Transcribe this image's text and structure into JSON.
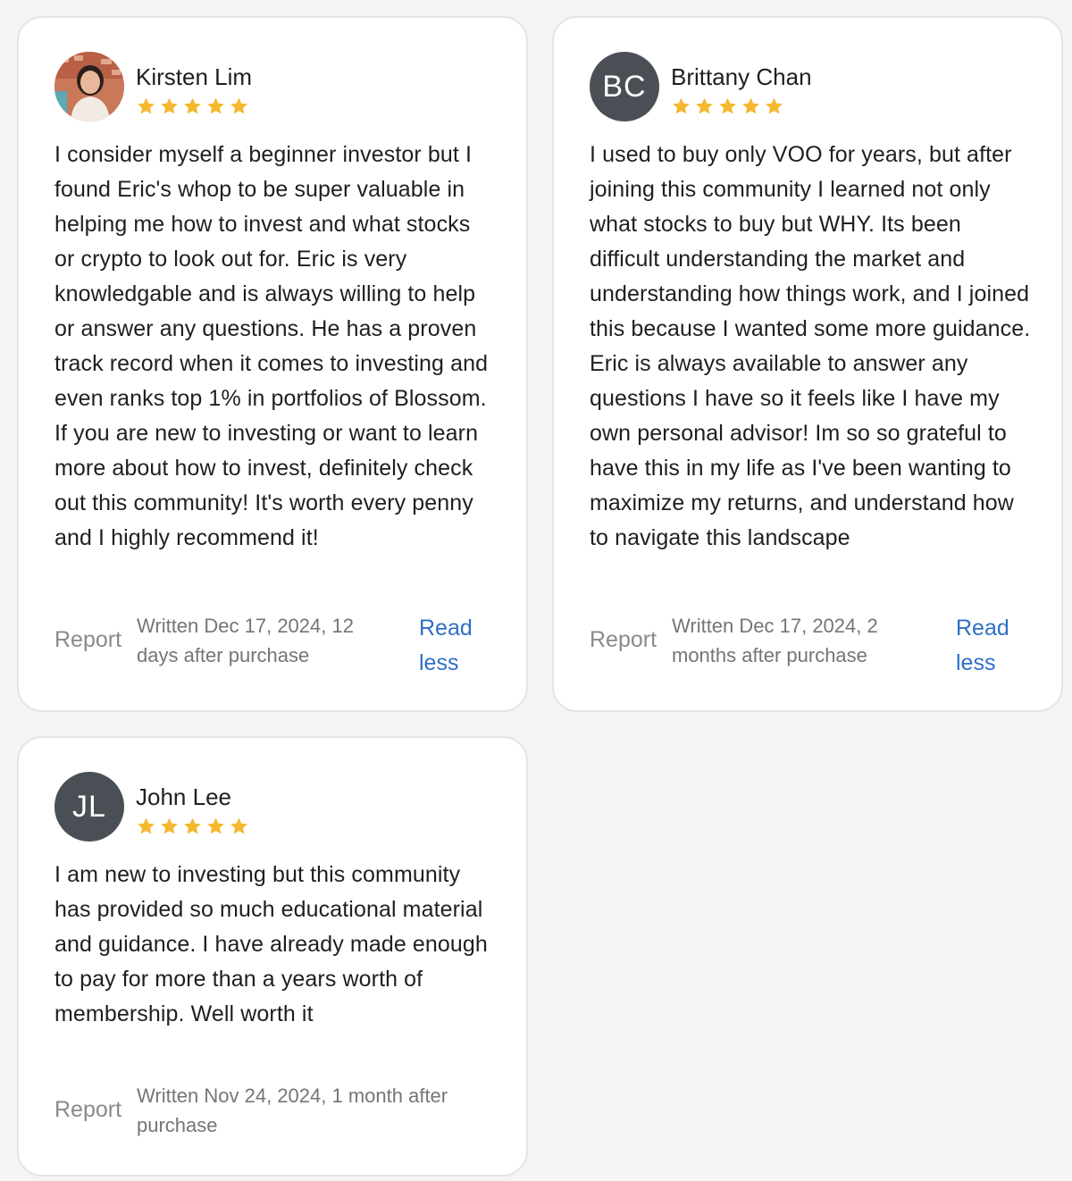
{
  "reviews": [
    {
      "name": "Kirsten Lim",
      "avatar_initials": "",
      "rating": 5,
      "text": "I consider myself a beginner investor but I found Eric's whop to be super valuable in helping me how to invest and what stocks or crypto to look out for. Eric is very knowledgable and is always willing to help or answer any questions. He has a proven track record when it comes to investing and even ranks top 1% in portfolios of Blossom. If you are new to investing or want to learn more about how to invest, definitely check out this community! It's worth every penny and I highly recommend it!",
      "report_label": "Report",
      "written_line1": "Written Dec 17, 2024, 12",
      "written_line2": "days after purchase",
      "read_less_line1": "Read",
      "read_less_line2": "less"
    },
    {
      "name": "Brittany Chan",
      "avatar_initials": "BC",
      "rating": 5,
      "text": "I used to buy only VOO for years, but after joining this community I learned not only what stocks to buy but WHY. Its been difficult understanding the market and understanding how things work, and I joined this because I wanted some more guidance. Eric is always available to answer any questions I have so it feels like I have my own personal advisor! Im so so grateful to have this in my life as I've been wanting to maximize my returns, and understand how to navigate this landscape",
      "report_label": "Report",
      "written_line1": "Written Dec 17, 2024, 2",
      "written_line2": "months after purchase",
      "read_less_line1": "Read",
      "read_less_line2": "less"
    },
    {
      "name": "John Lee",
      "avatar_initials": "JL",
      "rating": 5,
      "text": "I am new to investing but this community has provided so much educational material and guidance. I have already made enough to pay for more than a years worth of membership. Well worth it",
      "report_label": "Report",
      "written_line1": "Written Nov 24, 2024, 1 month after",
      "written_line2": "purchase"
    }
  ],
  "colors": {
    "star": "#f5b82e",
    "link": "#2f6fc6",
    "avatar_bg": "#4a4f56",
    "muted": "#8a8a8a"
  }
}
